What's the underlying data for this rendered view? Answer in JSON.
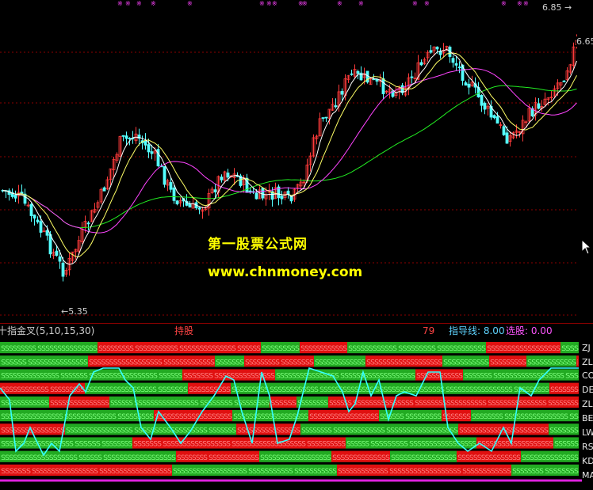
{
  "colors": {
    "background": "#000000",
    "up_candle": "#ff3b3b",
    "down_candle": "#54ffff",
    "ma5": "#ffffff",
    "ma10": "#ffff66",
    "ma20": "#ff44ff",
    "ma60": "#22ee22",
    "grid": "#8b0000",
    "indicator_line": "#33ffff",
    "red_band": "#e01010",
    "green_band": "#22aa22",
    "watermark": "#ffff00",
    "divider": "#dd22dd"
  },
  "price_chart": {
    "high_marker": "6.85",
    "right_price_label": "6.65",
    "low_marker": "5.35",
    "watermark_cn": "第一股票公式网",
    "watermark_url": "www.chnmoney.com"
  },
  "indicator_panel": {
    "name": "十指金叉",
    "params": "(5,10,15,30)",
    "holding_label": "持股",
    "score_value": "79",
    "guide_line_label": "指导线: 8.00",
    "select_label": "选股: 0.00",
    "row_labels": [
      "ZJ",
      "ZL",
      "CO",
      "DE",
      "ZL",
      "BE",
      "LW",
      "RS",
      "KD",
      "MA"
    ],
    "pattern_glyph": "S"
  }
}
